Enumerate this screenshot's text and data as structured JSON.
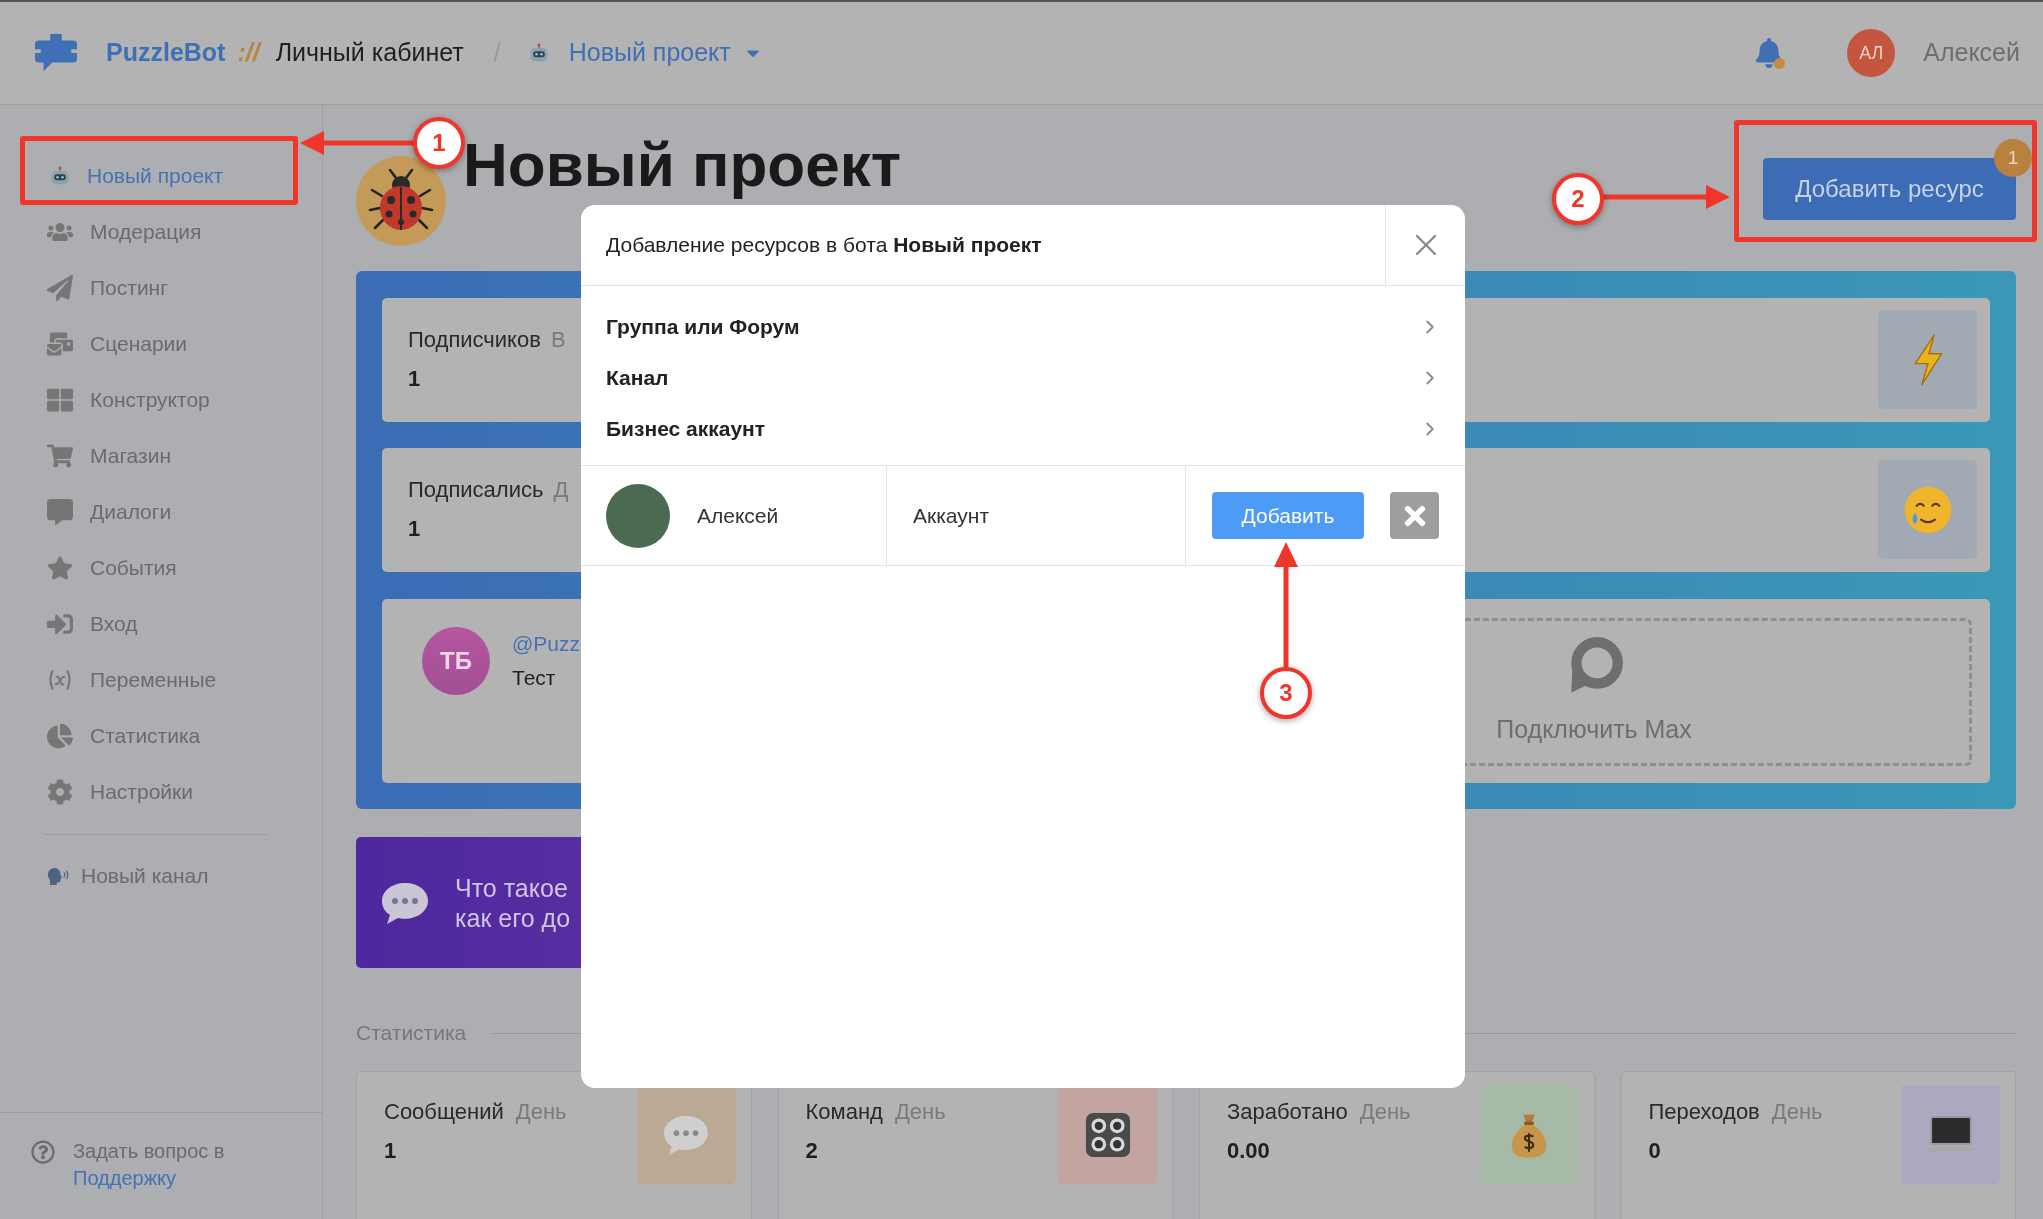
{
  "header": {
    "brand": "PuzzleBot",
    "brand_separator": "://",
    "section": "Личный кабинет",
    "crumb_separator": "/",
    "project": "Новый проект",
    "notifications": {
      "unread": true
    },
    "user": {
      "initials": "АЛ",
      "name": "Алексей"
    }
  },
  "sidebar": {
    "items": [
      {
        "label": "Новый проект",
        "selected": true
      },
      {
        "label": "Модерация",
        "selected": false
      },
      {
        "label": "Постинг",
        "selected": false
      },
      {
        "label": "Сценарии",
        "selected": false
      },
      {
        "label": "Конструктор",
        "selected": false
      },
      {
        "label": "Магазин",
        "selected": false
      },
      {
        "label": "Диалоги",
        "selected": false
      },
      {
        "label": "События",
        "selected": false
      },
      {
        "label": "Вход",
        "selected": false
      },
      {
        "label": "Переменные",
        "selected": false
      },
      {
        "label": "Статистика",
        "selected": false
      },
      {
        "label": "Настройки",
        "selected": false
      }
    ],
    "bots": [
      {
        "label": "Новый канал"
      }
    ],
    "help": {
      "text": "Задать вопрос в",
      "link": "Поддержку"
    }
  },
  "page": {
    "title": "Новый проект",
    "add_resource": {
      "label": "Добавить ресурс",
      "badge": "1"
    }
  },
  "overview": {
    "stats": [
      {
        "label": "Подписчиков",
        "period": "В",
        "value": "1"
      },
      {
        "label": "Подписались",
        "period": "Д",
        "value": "1"
      }
    ],
    "account": {
      "initials": "ТБ",
      "username": "@Puzz",
      "name": "Тест"
    },
    "connect": {
      "label": "Подключить Max"
    }
  },
  "banner": {
    "text": "Что такое\nкак его до"
  },
  "statistics": {
    "title": "Статистика",
    "cards": [
      {
        "label": "Сообщений",
        "period": "День",
        "value": "1",
        "color": "#bba994"
      },
      {
        "label": "Команд",
        "period": "День",
        "value": "2",
        "color": "#c2a4a1"
      },
      {
        "label": "Заработано",
        "period": "День",
        "value": "0.00",
        "color": "#a7b9a7"
      },
      {
        "label": "Переходов",
        "period": "День",
        "value": "0",
        "color": "#aba8c0"
      }
    ]
  },
  "dialog": {
    "title": "Добавление ресурсов в бота **Новый проект**",
    "options": [
      {
        "label": "Группа или Форум"
      },
      {
        "label": "Канал"
      },
      {
        "label": "Бизнес аккаунт"
      }
    ],
    "accounts": [
      {
        "name": "Алексей",
        "type": "Аккаунт",
        "action": "Добавить"
      }
    ]
  },
  "annotations": [
    {
      "number": "1"
    },
    {
      "number": "2"
    },
    {
      "number": "3"
    }
  ]
}
